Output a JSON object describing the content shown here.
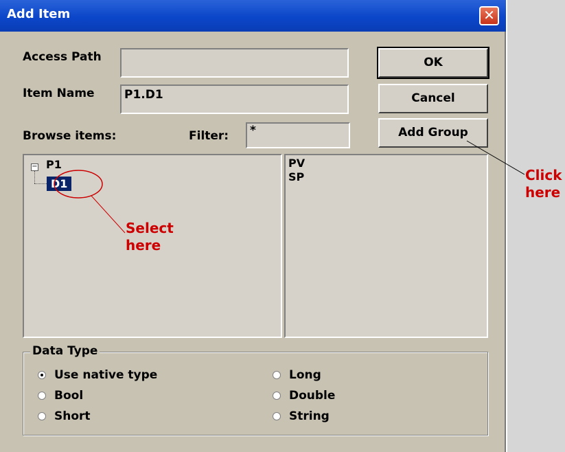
{
  "window": {
    "title": "Add Item",
    "close_glyph": "✕"
  },
  "form": {
    "access_path_label": "Access Path",
    "access_path_value": "",
    "item_name_label": "Item Name",
    "item_name_value": "P1.D1",
    "browse_label": "Browse items:",
    "filter_label": "Filter:",
    "filter_value": "*"
  },
  "buttons": {
    "ok": "OK",
    "cancel": "Cancel",
    "add_group": "Add Group"
  },
  "tree": {
    "root": "P1",
    "root_toggle": "−",
    "children": [
      {
        "label": "D1",
        "selected": true
      }
    ]
  },
  "items_list": [
    "PV",
    "SP"
  ],
  "data_type": {
    "title": "Data Type",
    "options": [
      {
        "label": "Use native type",
        "checked": true
      },
      {
        "label": "Bool",
        "checked": false
      },
      {
        "label": "Short",
        "checked": false
      },
      {
        "label": "Long",
        "checked": false
      },
      {
        "label": "Double",
        "checked": false
      },
      {
        "label": "String",
        "checked": false
      }
    ]
  },
  "annotations": {
    "select_line1": "Select",
    "select_line2": "here",
    "click_line1": "Click",
    "click_line2": "here"
  },
  "colors": {
    "titlebar": "#0b46c9",
    "dialog": "#c8c2b3",
    "selection": "#0a246a",
    "annotation": "#cc0000"
  }
}
